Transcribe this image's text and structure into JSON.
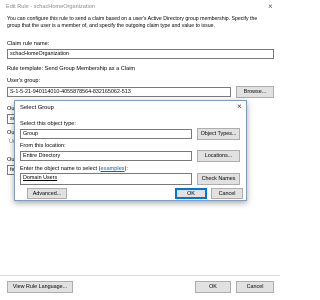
{
  "outer": {
    "title": "Edit Rule - schacHomeOrganization",
    "description": "You can configure this rule to send a claim based on a user's Active Directory group membership. Specify the group that the user is a member of, and specify the outgoing claim type and value to issue.",
    "claim_rule_name_label": "Claim rule name:",
    "claim_rule_name_value": "schacHomeOrganization",
    "rule_template": "Rule template: Send Group Membership as a Claim",
    "users_group_label": "User's group:",
    "users_group_value": "S-1-5-21-940114010-4055878564-832165062-513",
    "browse_button": "Browse...",
    "outgoing_claim_type_label": "Out",
    "outgoing_claim_type_value": "sch",
    "outgoing_name_id_label": "Ou",
    "outgoing_name_id_value": "Un",
    "outgoing_claim_value_label": "Ou",
    "outgoing_claim_value_value": "fe",
    "view_rule_language_button": "View Rule Language...",
    "ok_button": "OK",
    "cancel_button": "Cancel"
  },
  "select_group": {
    "title": "Select Group",
    "object_type_label": "Select this object type:",
    "object_type_value": "Group",
    "object_types_button": "Object Types...",
    "location_label": "From this location:",
    "location_value": "Entire Directory",
    "locations_button": "Locations...",
    "enter_names_label_prefix": "Enter the object name to select (",
    "enter_names_link": "examples",
    "enter_names_label_suffix": "):",
    "names_value": "Domain Users",
    "check_names_button": "Check Names",
    "advanced_button": "Advanced...",
    "ok_button": "OK",
    "cancel_button": "Cancel"
  },
  "icons": {
    "close": "×",
    "outer_close": "×"
  }
}
